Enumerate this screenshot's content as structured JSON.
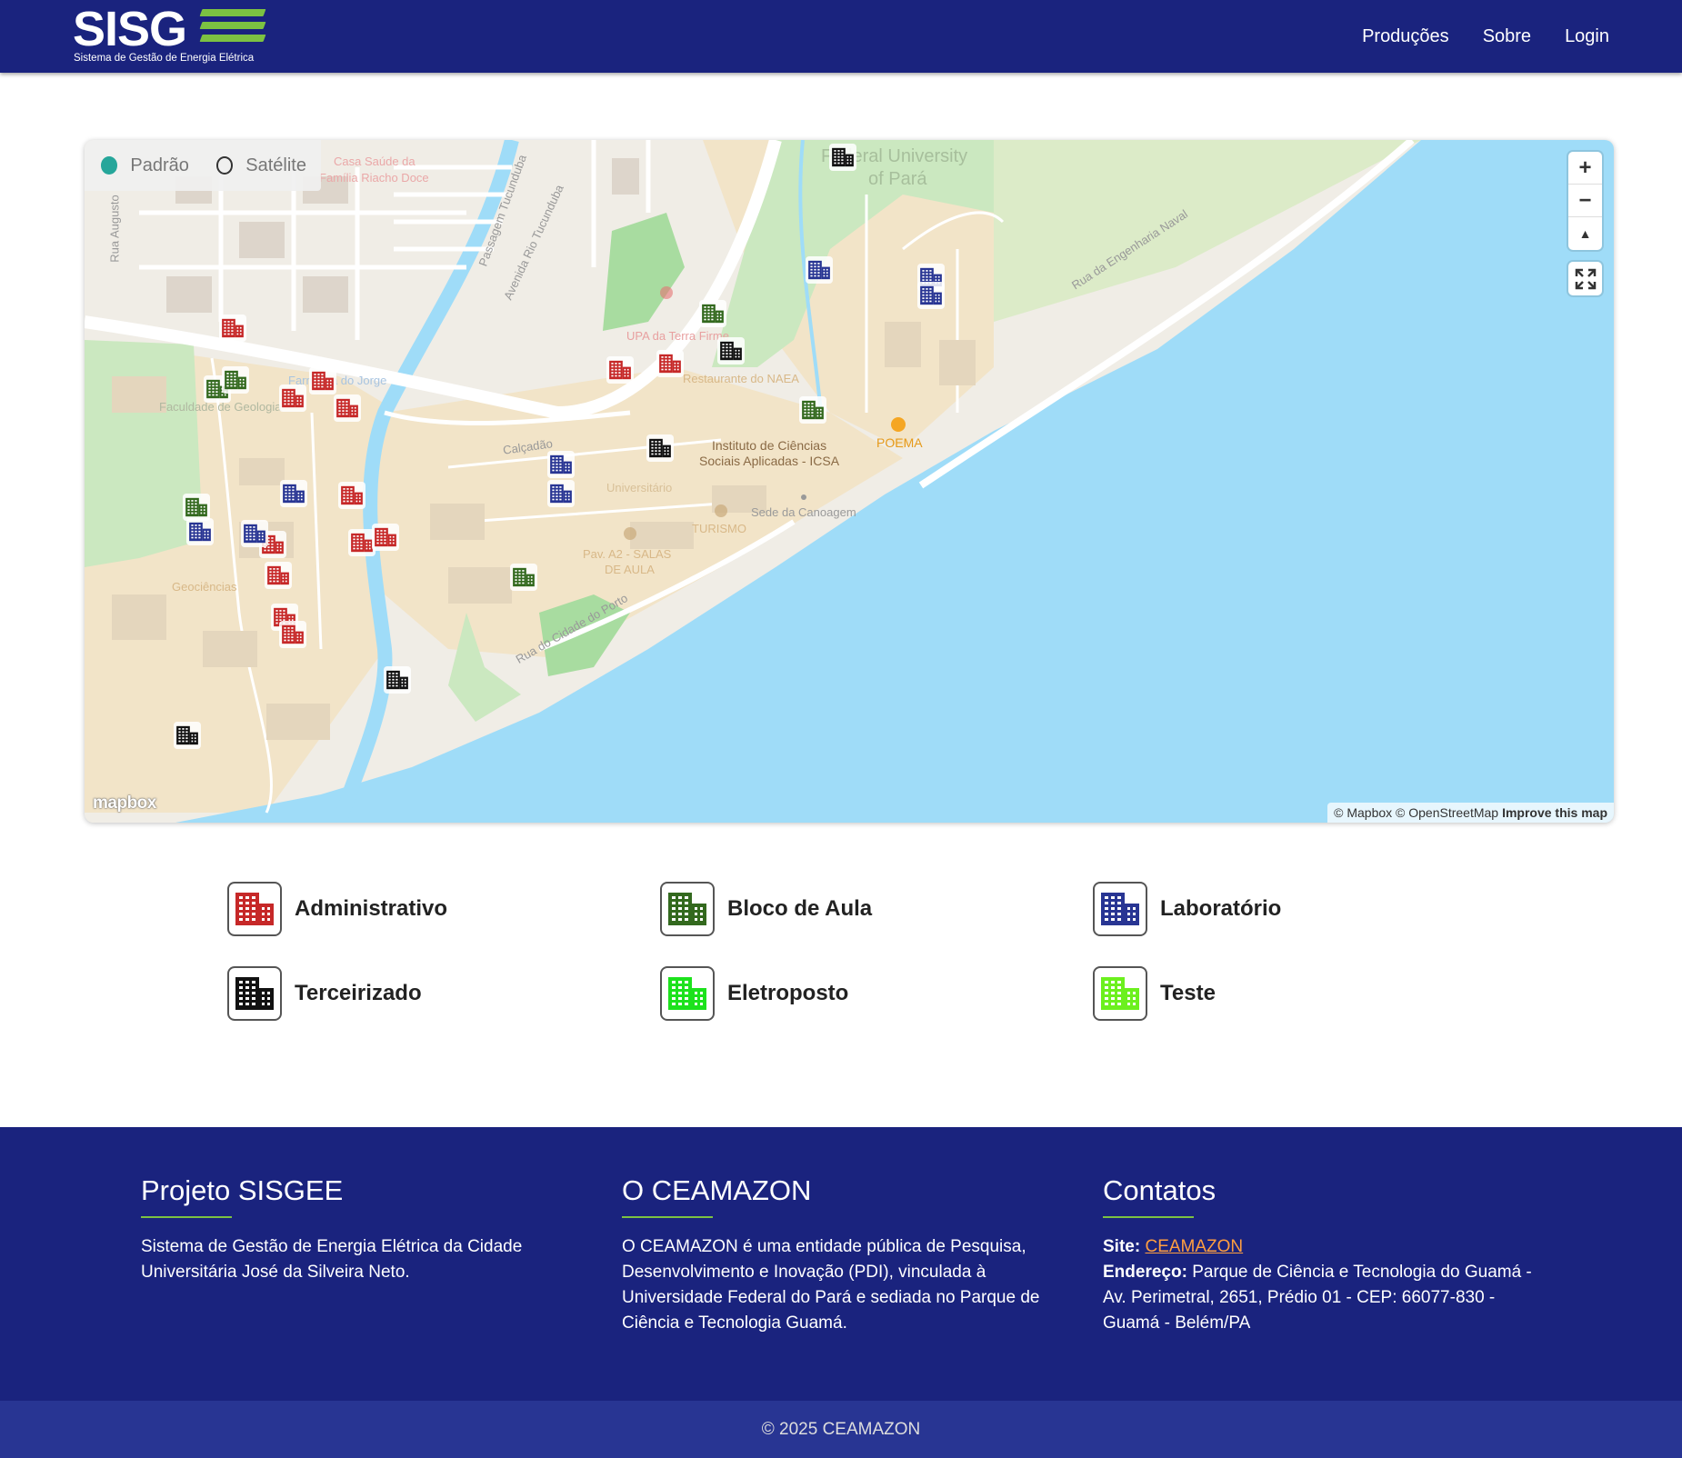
{
  "header": {
    "logo_text": "SISG",
    "logo_subtitle": "Sistema de Gestão de Energia Elétrica",
    "nav": [
      {
        "label": "Produções"
      },
      {
        "label": "Sobre"
      },
      {
        "label": "Login"
      }
    ]
  },
  "map": {
    "style_options": [
      {
        "label": "Padrão",
        "selected": true
      },
      {
        "label": "Satélite",
        "selected": false
      }
    ],
    "zoom_in": "+",
    "zoom_out": "−",
    "compass": "▲",
    "mapbox_logo": "mapbox",
    "attribution": "© Mapbox © OpenStreetMap",
    "improve_link": "Improve this map",
    "labels": {
      "federal": "Federal University",
      "federal2": "of Pará",
      "icsa1": "Instituto de Ciências",
      "icsa2": "Sociais Aplicadas - ICSA",
      "poema": "POEMA",
      "sede": "Sede da Canoagem",
      "calcadao": "Calçadão",
      "upa": "UPA da Terra Firme",
      "farmacia": "Farmácia do Jorge",
      "faculdade": "Faculdade de Geologia",
      "restaurante": "Restaurante do NAEA",
      "universitario": "Universitário",
      "turismo": "TURISMO",
      "pav": "Pav. A2 - SALAS",
      "pav2": "DE AULA",
      "casa": "Casa Saúde da",
      "casa2": "Família Riacho Doce",
      "rua_augusto": "Rua Augusto",
      "passagem": "Passagem Tucunduba",
      "avenida": "Avenida Rio Tucunduba",
      "engenharia": "Rua da Engenharia Naval",
      "estrada": "Rua do Cidade do Porto",
      "geociencias": "Geociências"
    }
  },
  "legend": [
    {
      "label": "Administrativo",
      "color": "#c62828"
    },
    {
      "label": "Bloco de Aula",
      "color": "#33691e"
    },
    {
      "label": "Laboratório",
      "color": "#283593"
    },
    {
      "label": "Terceirizado",
      "color": "#111111"
    },
    {
      "label": "Eletroposto",
      "color": "#1de21d"
    },
    {
      "label": "Teste",
      "color": "#6cf01e"
    }
  ],
  "footer": {
    "col1": {
      "title": "Projeto SISGEE",
      "text": "Sistema de Gestão de Energia Elétrica da Cidade Universitária José da Silveira Neto."
    },
    "col2": {
      "title": "O CEAMAZON",
      "text": "O CEAMAZON é uma entidade pública de Pesquisa, Desenvolvimento e Inovação (PDI), vinculada à Universidade Federal do Pará e sediada no Parque de Ciência e Tecnologia Guamá."
    },
    "col3": {
      "title": "Contatos",
      "site_label": "Site:",
      "site_value": "CEAMAZON",
      "address_label": "Endereço:",
      "address_value": "Parque de Ciência e Tecnologia do Guamá - Av. Perimetral, 2651, Prédio 01 - CEP: 66077-830 - Guamá - Belém/PA"
    },
    "copyright": "© 2025 CEAMAZON"
  },
  "colors": {
    "header_bg": "#1a237e",
    "footer_bottom_bg": "#283593",
    "accent_green": "#7cc242",
    "link_orange": "#ff9e40",
    "water": "#9fdcf8"
  },
  "marker_types": {
    "admin": "#c62828",
    "aula": "#33691e",
    "lab": "#283593",
    "terc": "#111111"
  }
}
